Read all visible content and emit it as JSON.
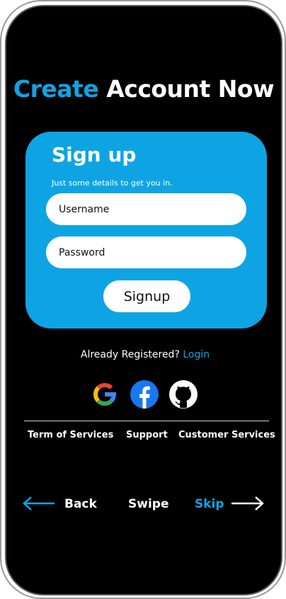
{
  "header": {
    "title_accent": "Create",
    "title_rest": "Account Now"
  },
  "signup_card": {
    "title": "Sign up",
    "subtitle": "Just some details to get you in.",
    "username_placeholder": "Username",
    "password_placeholder": "Password",
    "submit_label": "Signup"
  },
  "login_prompt": {
    "text": "Already Registered?",
    "link": "Login"
  },
  "social_buttons": [
    "google-icon",
    "facebook-icon",
    "github-icon"
  ],
  "footer_links": [
    "Term of Services",
    "Support",
    "Customer Services"
  ],
  "bottom_nav": {
    "back": "Back",
    "swipe": "Swipe",
    "skip": "Skip"
  },
  "colors": {
    "accent": "#0ea4e4",
    "background": "#000000",
    "text": "#ffffff"
  }
}
